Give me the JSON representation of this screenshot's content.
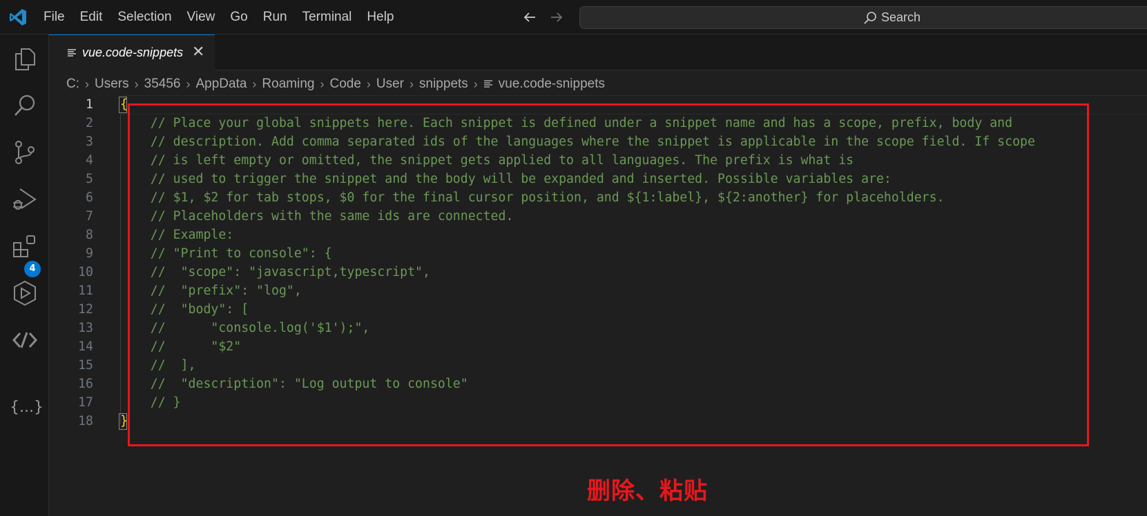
{
  "menu": [
    "File",
    "Edit",
    "Selection",
    "View",
    "Go",
    "Run",
    "Terminal",
    "Help"
  ],
  "search": {
    "label": "Search"
  },
  "activity_bar": {
    "icons": [
      "explorer-icon",
      "search-icon",
      "source-control-icon",
      "run-debug-icon",
      "extensions-icon",
      "remote-explorer-icon",
      "remote-connection-icon",
      "json-icon"
    ],
    "extensions_badge": "4",
    "braces_label": "{...}"
  },
  "tab": {
    "label": "vue.code-snippets"
  },
  "breadcrumb": [
    "C:",
    "Users",
    "35456",
    "AppData",
    "Roaming",
    "Code",
    "User",
    "snippets",
    "vue.code-snippets"
  ],
  "editor": {
    "lines": [
      {
        "num": "1",
        "text": "{"
      },
      {
        "num": "2",
        "text": "    // Place your global snippets here. Each snippet is defined under a snippet name and has a scope, prefix, body and"
      },
      {
        "num": "3",
        "text": "    // description. Add comma separated ids of the languages where the snippet is applicable in the scope field. If scope"
      },
      {
        "num": "4",
        "text": "    // is left empty or omitted, the snippet gets applied to all languages. The prefix is what is"
      },
      {
        "num": "5",
        "text": "    // used to trigger the snippet and the body will be expanded and inserted. Possible variables are:"
      },
      {
        "num": "6",
        "text": "    // $1, $2 for tab stops, $0 for the final cursor position, and ${1:label}, ${2:another} for placeholders."
      },
      {
        "num": "7",
        "text": "    // Placeholders with the same ids are connected."
      },
      {
        "num": "8",
        "text": "    // Example:"
      },
      {
        "num": "9",
        "text": "    // \"Print to console\": {"
      },
      {
        "num": "10",
        "text": "    //  \"scope\": \"javascript,typescript\","
      },
      {
        "num": "11",
        "text": "    //  \"prefix\": \"log\","
      },
      {
        "num": "12",
        "text": "    //  \"body\": ["
      },
      {
        "num": "13",
        "text": "    //      \"console.log('$1');\","
      },
      {
        "num": "14",
        "text": "    //      \"$2\""
      },
      {
        "num": "15",
        "text": "    //  ],"
      },
      {
        "num": "16",
        "text": "    //  \"description\": \"Log output to console\""
      },
      {
        "num": "17",
        "text": "    // }"
      },
      {
        "num": "18",
        "text": "}"
      }
    ]
  },
  "annotation": {
    "text": "删除、粘贴",
    "color": "#e8171d"
  },
  "colors": {
    "accent": "#0078d4",
    "comment": "#6a9955",
    "brace": "#ffd700"
  }
}
